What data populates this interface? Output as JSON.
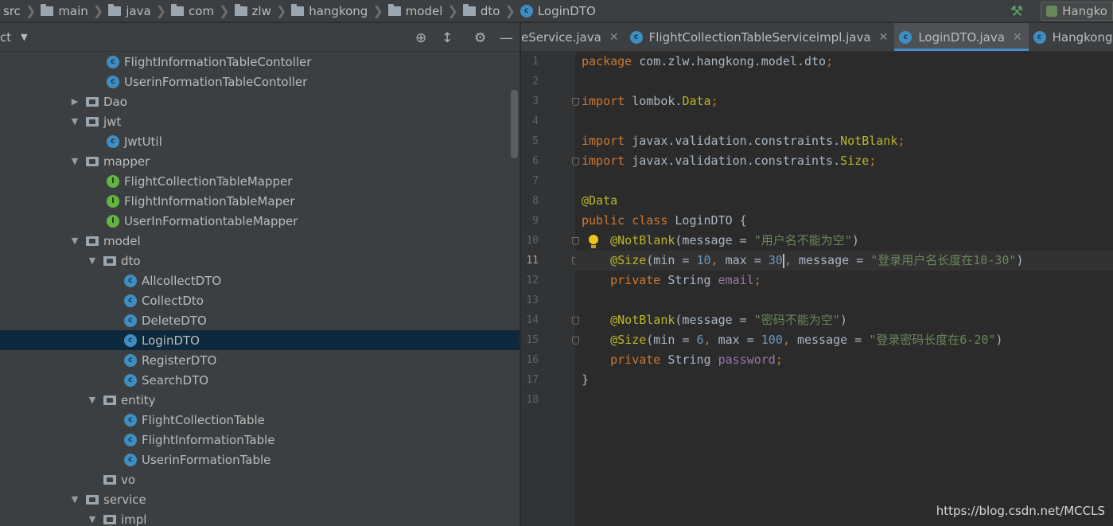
{
  "breadcrumb": {
    "items": [
      "src",
      "main",
      "java",
      "com",
      "zlw",
      "hangkong",
      "model",
      "dto",
      "LoginDTO"
    ],
    "run_config": "Hangko"
  },
  "project_panel": {
    "title": "ct",
    "icons": [
      "locate-icon",
      "collapse-icon",
      "gear-icon",
      "hide-icon"
    ],
    "tree": [
      {
        "label": "FlightInformationTableContoller",
        "kind": "class",
        "depth": 2
      },
      {
        "label": "UserinFormationTableContoller",
        "kind": "class",
        "depth": 2
      },
      {
        "label": "Dao",
        "kind": "folder",
        "depth": 1,
        "expanded": false
      },
      {
        "label": "jwt",
        "kind": "folder",
        "depth": 1,
        "expanded": true
      },
      {
        "label": "JwtUtil",
        "kind": "class",
        "depth": 2
      },
      {
        "label": "mapper",
        "kind": "folder",
        "depth": 1,
        "expanded": true
      },
      {
        "label": "FlightCollectionTableMapper",
        "kind": "interface",
        "depth": 2
      },
      {
        "label": "FlightInformationTableMaper",
        "kind": "interface",
        "depth": 2
      },
      {
        "label": "UserInFormationtableMapper",
        "kind": "interface",
        "depth": 2
      },
      {
        "label": "model",
        "kind": "folder",
        "depth": 1,
        "expanded": true
      },
      {
        "label": "dto",
        "kind": "folder",
        "depth": 2,
        "expanded": true
      },
      {
        "label": "AllcollectDTO",
        "kind": "class",
        "depth": 3
      },
      {
        "label": "CollectDto",
        "kind": "class",
        "depth": 3
      },
      {
        "label": "DeleteDTO",
        "kind": "class",
        "depth": 3
      },
      {
        "label": "LoginDTO",
        "kind": "class",
        "depth": 3,
        "selected": true
      },
      {
        "label": "RegisterDTO",
        "kind": "class",
        "depth": 3
      },
      {
        "label": "SearchDTO",
        "kind": "class",
        "depth": 3
      },
      {
        "label": "entity",
        "kind": "folder",
        "depth": 2,
        "expanded": true
      },
      {
        "label": "FlightCollectionTable",
        "kind": "class",
        "depth": 3
      },
      {
        "label": "FlightInformationTable",
        "kind": "class",
        "depth": 3
      },
      {
        "label": "UserinFormationTable",
        "kind": "class",
        "depth": 3
      },
      {
        "label": "vo",
        "kind": "folder",
        "depth": 2,
        "noarrow": true
      },
      {
        "label": "service",
        "kind": "folder",
        "depth": 1,
        "expanded": true
      },
      {
        "label": "impl",
        "kind": "folder",
        "depth": 2,
        "expanded": true
      }
    ]
  },
  "tabs": [
    {
      "label": "eService.java",
      "icon": false,
      "active": false
    },
    {
      "label": "FlightCollectionTableServiceimpl.java",
      "icon": true,
      "active": false
    },
    {
      "label": "LoginDTO.java",
      "icon": true,
      "active": true
    },
    {
      "label": "HangkongA",
      "icon": true,
      "active": false
    }
  ],
  "editor": {
    "current_line": 11,
    "lines": [
      [
        [
          "kw",
          "package "
        ],
        [
          "",
          "com.zlw.hangkong.model.dto"
        ],
        [
          "kw",
          ";"
        ]
      ],
      [],
      [
        [
          "kw",
          "import "
        ],
        [
          "",
          "lombok."
        ],
        [
          "ann",
          "Data"
        ],
        [
          "kw",
          ";"
        ]
      ],
      [],
      [
        [
          "kw",
          "import "
        ],
        [
          "",
          "javax.validation.constraints."
        ],
        [
          "ann",
          "NotBlank"
        ],
        [
          "kw",
          ";"
        ]
      ],
      [
        [
          "kw",
          "import "
        ],
        [
          "",
          "javax.validation.constraints."
        ],
        [
          "ann",
          "Size"
        ],
        [
          "kw",
          ";"
        ]
      ],
      [],
      [
        [
          "ann",
          "@Data"
        ]
      ],
      [
        [
          "kw",
          "public class "
        ],
        [
          "",
          "LoginDTO {"
        ]
      ],
      [
        [
          "",
          "    "
        ],
        [
          "ann",
          "@NotBlank"
        ],
        [
          "",
          "(message = "
        ],
        [
          "str",
          "\"用户名不能为空\""
        ],
        [
          "",
          ")"
        ]
      ],
      [
        [
          "",
          "    "
        ],
        [
          "ann",
          "@Size"
        ],
        [
          "",
          "(min = "
        ],
        [
          "num",
          "10"
        ],
        [
          "kw",
          ", "
        ],
        [
          "",
          "max = "
        ],
        [
          "num",
          "30"
        ],
        [
          "caret",
          ""
        ],
        [
          "kw",
          ", "
        ],
        [
          "",
          "message = "
        ],
        [
          "str",
          "\"登录用户名长度在10-30\""
        ],
        [
          "",
          ")"
        ]
      ],
      [
        [
          "",
          "    "
        ],
        [
          "kw",
          "private "
        ],
        [
          "",
          "String "
        ],
        [
          "fld",
          "email"
        ],
        [
          "kw",
          ";"
        ]
      ],
      [],
      [
        [
          "",
          "    "
        ],
        [
          "ann",
          "@NotBlank"
        ],
        [
          "",
          "(message = "
        ],
        [
          "str",
          "\"密码不能为空\""
        ],
        [
          "",
          ")"
        ]
      ],
      [
        [
          "",
          "    "
        ],
        [
          "ann",
          "@Size"
        ],
        [
          "",
          "(min = "
        ],
        [
          "num",
          "6"
        ],
        [
          "kw",
          ", "
        ],
        [
          "",
          "max = "
        ],
        [
          "num",
          "100"
        ],
        [
          "kw",
          ", "
        ],
        [
          "",
          "message = "
        ],
        [
          "str",
          "\"登录密码长度在6-20\""
        ],
        [
          "",
          ")"
        ]
      ],
      [
        [
          "",
          "    "
        ],
        [
          "kw",
          "private "
        ],
        [
          "",
          "String "
        ],
        [
          "fld",
          "password"
        ],
        [
          "kw",
          ";"
        ]
      ],
      [
        [
          "",
          "}"
        ]
      ],
      []
    ]
  },
  "watermark": "https://blog.csdn.net/MCCLS"
}
